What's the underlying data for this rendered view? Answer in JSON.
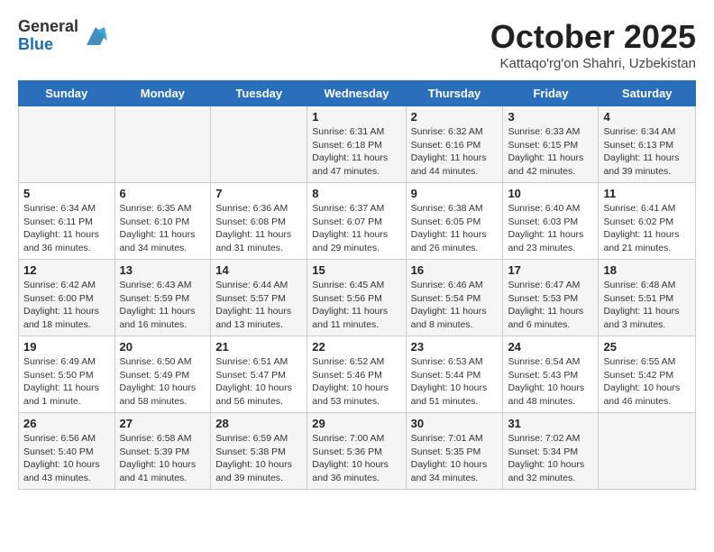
{
  "logo": {
    "general": "General",
    "blue": "Blue"
  },
  "title": "October 2025",
  "subtitle": "Kattaqo'rg'on Shahri, Uzbekistan",
  "days_of_week": [
    "Sunday",
    "Monday",
    "Tuesday",
    "Wednesday",
    "Thursday",
    "Friday",
    "Saturday"
  ],
  "weeks": [
    [
      {
        "day": "",
        "info": ""
      },
      {
        "day": "",
        "info": ""
      },
      {
        "day": "",
        "info": ""
      },
      {
        "day": "1",
        "info": "Sunrise: 6:31 AM\nSunset: 6:18 PM\nDaylight: 11 hours and 47 minutes."
      },
      {
        "day": "2",
        "info": "Sunrise: 6:32 AM\nSunset: 6:16 PM\nDaylight: 11 hours and 44 minutes."
      },
      {
        "day": "3",
        "info": "Sunrise: 6:33 AM\nSunset: 6:15 PM\nDaylight: 11 hours and 42 minutes."
      },
      {
        "day": "4",
        "info": "Sunrise: 6:34 AM\nSunset: 6:13 PM\nDaylight: 11 hours and 39 minutes."
      }
    ],
    [
      {
        "day": "5",
        "info": "Sunrise: 6:34 AM\nSunset: 6:11 PM\nDaylight: 11 hours and 36 minutes."
      },
      {
        "day": "6",
        "info": "Sunrise: 6:35 AM\nSunset: 6:10 PM\nDaylight: 11 hours and 34 minutes."
      },
      {
        "day": "7",
        "info": "Sunrise: 6:36 AM\nSunset: 6:08 PM\nDaylight: 11 hours and 31 minutes."
      },
      {
        "day": "8",
        "info": "Sunrise: 6:37 AM\nSunset: 6:07 PM\nDaylight: 11 hours and 29 minutes."
      },
      {
        "day": "9",
        "info": "Sunrise: 6:38 AM\nSunset: 6:05 PM\nDaylight: 11 hours and 26 minutes."
      },
      {
        "day": "10",
        "info": "Sunrise: 6:40 AM\nSunset: 6:03 PM\nDaylight: 11 hours and 23 minutes."
      },
      {
        "day": "11",
        "info": "Sunrise: 6:41 AM\nSunset: 6:02 PM\nDaylight: 11 hours and 21 minutes."
      }
    ],
    [
      {
        "day": "12",
        "info": "Sunrise: 6:42 AM\nSunset: 6:00 PM\nDaylight: 11 hours and 18 minutes."
      },
      {
        "day": "13",
        "info": "Sunrise: 6:43 AM\nSunset: 5:59 PM\nDaylight: 11 hours and 16 minutes."
      },
      {
        "day": "14",
        "info": "Sunrise: 6:44 AM\nSunset: 5:57 PM\nDaylight: 11 hours and 13 minutes."
      },
      {
        "day": "15",
        "info": "Sunrise: 6:45 AM\nSunset: 5:56 PM\nDaylight: 11 hours and 11 minutes."
      },
      {
        "day": "16",
        "info": "Sunrise: 6:46 AM\nSunset: 5:54 PM\nDaylight: 11 hours and 8 minutes."
      },
      {
        "day": "17",
        "info": "Sunrise: 6:47 AM\nSunset: 5:53 PM\nDaylight: 11 hours and 6 minutes."
      },
      {
        "day": "18",
        "info": "Sunrise: 6:48 AM\nSunset: 5:51 PM\nDaylight: 11 hours and 3 minutes."
      }
    ],
    [
      {
        "day": "19",
        "info": "Sunrise: 6:49 AM\nSunset: 5:50 PM\nDaylight: 11 hours and 1 minute."
      },
      {
        "day": "20",
        "info": "Sunrise: 6:50 AM\nSunset: 5:49 PM\nDaylight: 10 hours and 58 minutes."
      },
      {
        "day": "21",
        "info": "Sunrise: 6:51 AM\nSunset: 5:47 PM\nDaylight: 10 hours and 56 minutes."
      },
      {
        "day": "22",
        "info": "Sunrise: 6:52 AM\nSunset: 5:46 PM\nDaylight: 10 hours and 53 minutes."
      },
      {
        "day": "23",
        "info": "Sunrise: 6:53 AM\nSunset: 5:44 PM\nDaylight: 10 hours and 51 minutes."
      },
      {
        "day": "24",
        "info": "Sunrise: 6:54 AM\nSunset: 5:43 PM\nDaylight: 10 hours and 48 minutes."
      },
      {
        "day": "25",
        "info": "Sunrise: 6:55 AM\nSunset: 5:42 PM\nDaylight: 10 hours and 46 minutes."
      }
    ],
    [
      {
        "day": "26",
        "info": "Sunrise: 6:56 AM\nSunset: 5:40 PM\nDaylight: 10 hours and 43 minutes."
      },
      {
        "day": "27",
        "info": "Sunrise: 6:58 AM\nSunset: 5:39 PM\nDaylight: 10 hours and 41 minutes."
      },
      {
        "day": "28",
        "info": "Sunrise: 6:59 AM\nSunset: 5:38 PM\nDaylight: 10 hours and 39 minutes."
      },
      {
        "day": "29",
        "info": "Sunrise: 7:00 AM\nSunset: 5:36 PM\nDaylight: 10 hours and 36 minutes."
      },
      {
        "day": "30",
        "info": "Sunrise: 7:01 AM\nSunset: 5:35 PM\nDaylight: 10 hours and 34 minutes."
      },
      {
        "day": "31",
        "info": "Sunrise: 7:02 AM\nSunset: 5:34 PM\nDaylight: 10 hours and 32 minutes."
      },
      {
        "day": "",
        "info": ""
      }
    ]
  ]
}
